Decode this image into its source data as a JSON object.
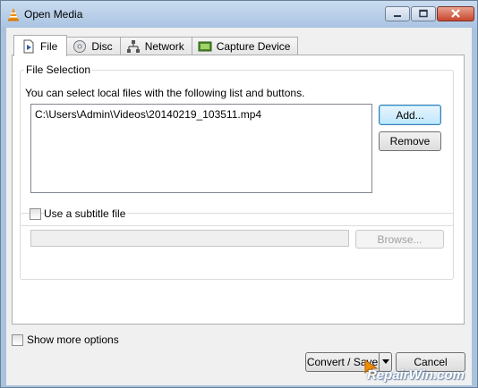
{
  "window": {
    "title": "Open Media"
  },
  "tabs": [
    {
      "label": "File",
      "icon": "file-icon"
    },
    {
      "label": "Disc",
      "icon": "disc-icon"
    },
    {
      "label": "Network",
      "icon": "network-icon"
    },
    {
      "label": "Capture Device",
      "icon": "capture-device-icon"
    }
  ],
  "file_selection": {
    "legend": "File Selection",
    "hint": "You can select local files with the following list and buttons.",
    "files": [
      "C:\\Users\\Admin\\Videos\\20140219_103511.mp4"
    ],
    "add_label": "Add...",
    "remove_label": "Remove"
  },
  "subtitle": {
    "checkbox_label": "Use a subtitle file",
    "checked": false,
    "path_value": "",
    "browse_label": "Browse..."
  },
  "footer": {
    "show_more_label": "Show more options",
    "convert_save_label": "Convert / Save",
    "cancel_label": "Cancel"
  },
  "watermark": "RepairWin.com",
  "colors": {
    "accent": "#3c7fb1",
    "title_bar": "#aac4e2",
    "close_button": "#c8452e",
    "vlc_orange": "#f28c00"
  }
}
